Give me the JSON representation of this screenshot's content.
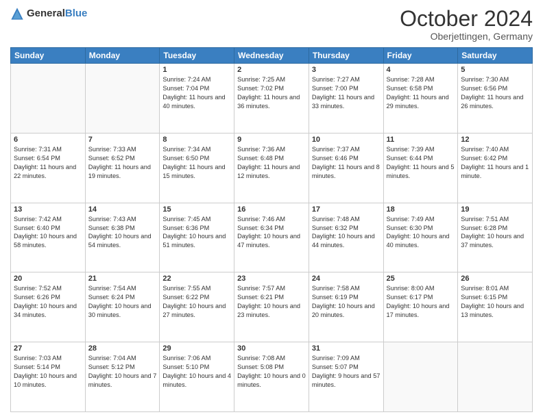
{
  "header": {
    "logo_general": "General",
    "logo_blue": "Blue",
    "title": "October 2024",
    "location": "Oberjettingen, Germany"
  },
  "weekdays": [
    "Sunday",
    "Monday",
    "Tuesday",
    "Wednesday",
    "Thursday",
    "Friday",
    "Saturday"
  ],
  "weeks": [
    [
      {
        "day": "",
        "sunrise": "",
        "sunset": "",
        "daylight": ""
      },
      {
        "day": "",
        "sunrise": "",
        "sunset": "",
        "daylight": ""
      },
      {
        "day": "1",
        "sunrise": "Sunrise: 7:24 AM",
        "sunset": "Sunset: 7:04 PM",
        "daylight": "Daylight: 11 hours and 40 minutes."
      },
      {
        "day": "2",
        "sunrise": "Sunrise: 7:25 AM",
        "sunset": "Sunset: 7:02 PM",
        "daylight": "Daylight: 11 hours and 36 minutes."
      },
      {
        "day": "3",
        "sunrise": "Sunrise: 7:27 AM",
        "sunset": "Sunset: 7:00 PM",
        "daylight": "Daylight: 11 hours and 33 minutes."
      },
      {
        "day": "4",
        "sunrise": "Sunrise: 7:28 AM",
        "sunset": "Sunset: 6:58 PM",
        "daylight": "Daylight: 11 hours and 29 minutes."
      },
      {
        "day": "5",
        "sunrise": "Sunrise: 7:30 AM",
        "sunset": "Sunset: 6:56 PM",
        "daylight": "Daylight: 11 hours and 26 minutes."
      }
    ],
    [
      {
        "day": "6",
        "sunrise": "Sunrise: 7:31 AM",
        "sunset": "Sunset: 6:54 PM",
        "daylight": "Daylight: 11 hours and 22 minutes."
      },
      {
        "day": "7",
        "sunrise": "Sunrise: 7:33 AM",
        "sunset": "Sunset: 6:52 PM",
        "daylight": "Daylight: 11 hours and 19 minutes."
      },
      {
        "day": "8",
        "sunrise": "Sunrise: 7:34 AM",
        "sunset": "Sunset: 6:50 PM",
        "daylight": "Daylight: 11 hours and 15 minutes."
      },
      {
        "day": "9",
        "sunrise": "Sunrise: 7:36 AM",
        "sunset": "Sunset: 6:48 PM",
        "daylight": "Daylight: 11 hours and 12 minutes."
      },
      {
        "day": "10",
        "sunrise": "Sunrise: 7:37 AM",
        "sunset": "Sunset: 6:46 PM",
        "daylight": "Daylight: 11 hours and 8 minutes."
      },
      {
        "day": "11",
        "sunrise": "Sunrise: 7:39 AM",
        "sunset": "Sunset: 6:44 PM",
        "daylight": "Daylight: 11 hours and 5 minutes."
      },
      {
        "day": "12",
        "sunrise": "Sunrise: 7:40 AM",
        "sunset": "Sunset: 6:42 PM",
        "daylight": "Daylight: 11 hours and 1 minute."
      }
    ],
    [
      {
        "day": "13",
        "sunrise": "Sunrise: 7:42 AM",
        "sunset": "Sunset: 6:40 PM",
        "daylight": "Daylight: 10 hours and 58 minutes."
      },
      {
        "day": "14",
        "sunrise": "Sunrise: 7:43 AM",
        "sunset": "Sunset: 6:38 PM",
        "daylight": "Daylight: 10 hours and 54 minutes."
      },
      {
        "day": "15",
        "sunrise": "Sunrise: 7:45 AM",
        "sunset": "Sunset: 6:36 PM",
        "daylight": "Daylight: 10 hours and 51 minutes."
      },
      {
        "day": "16",
        "sunrise": "Sunrise: 7:46 AM",
        "sunset": "Sunset: 6:34 PM",
        "daylight": "Daylight: 10 hours and 47 minutes."
      },
      {
        "day": "17",
        "sunrise": "Sunrise: 7:48 AM",
        "sunset": "Sunset: 6:32 PM",
        "daylight": "Daylight: 10 hours and 44 minutes."
      },
      {
        "day": "18",
        "sunrise": "Sunrise: 7:49 AM",
        "sunset": "Sunset: 6:30 PM",
        "daylight": "Daylight: 10 hours and 40 minutes."
      },
      {
        "day": "19",
        "sunrise": "Sunrise: 7:51 AM",
        "sunset": "Sunset: 6:28 PM",
        "daylight": "Daylight: 10 hours and 37 minutes."
      }
    ],
    [
      {
        "day": "20",
        "sunrise": "Sunrise: 7:52 AM",
        "sunset": "Sunset: 6:26 PM",
        "daylight": "Daylight: 10 hours and 34 minutes."
      },
      {
        "day": "21",
        "sunrise": "Sunrise: 7:54 AM",
        "sunset": "Sunset: 6:24 PM",
        "daylight": "Daylight: 10 hours and 30 minutes."
      },
      {
        "day": "22",
        "sunrise": "Sunrise: 7:55 AM",
        "sunset": "Sunset: 6:22 PM",
        "daylight": "Daylight: 10 hours and 27 minutes."
      },
      {
        "day": "23",
        "sunrise": "Sunrise: 7:57 AM",
        "sunset": "Sunset: 6:21 PM",
        "daylight": "Daylight: 10 hours and 23 minutes."
      },
      {
        "day": "24",
        "sunrise": "Sunrise: 7:58 AM",
        "sunset": "Sunset: 6:19 PM",
        "daylight": "Daylight: 10 hours and 20 minutes."
      },
      {
        "day": "25",
        "sunrise": "Sunrise: 8:00 AM",
        "sunset": "Sunset: 6:17 PM",
        "daylight": "Daylight: 10 hours and 17 minutes."
      },
      {
        "day": "26",
        "sunrise": "Sunrise: 8:01 AM",
        "sunset": "Sunset: 6:15 PM",
        "daylight": "Daylight: 10 hours and 13 minutes."
      }
    ],
    [
      {
        "day": "27",
        "sunrise": "Sunrise: 7:03 AM",
        "sunset": "Sunset: 5:14 PM",
        "daylight": "Daylight: 10 hours and 10 minutes."
      },
      {
        "day": "28",
        "sunrise": "Sunrise: 7:04 AM",
        "sunset": "Sunset: 5:12 PM",
        "daylight": "Daylight: 10 hours and 7 minutes."
      },
      {
        "day": "29",
        "sunrise": "Sunrise: 7:06 AM",
        "sunset": "Sunset: 5:10 PM",
        "daylight": "Daylight: 10 hours and 4 minutes."
      },
      {
        "day": "30",
        "sunrise": "Sunrise: 7:08 AM",
        "sunset": "Sunset: 5:08 PM",
        "daylight": "Daylight: 10 hours and 0 minutes."
      },
      {
        "day": "31",
        "sunrise": "Sunrise: 7:09 AM",
        "sunset": "Sunset: 5:07 PM",
        "daylight": "Daylight: 9 hours and 57 minutes."
      },
      {
        "day": "",
        "sunrise": "",
        "sunset": "",
        "daylight": ""
      },
      {
        "day": "",
        "sunrise": "",
        "sunset": "",
        "daylight": ""
      }
    ]
  ]
}
